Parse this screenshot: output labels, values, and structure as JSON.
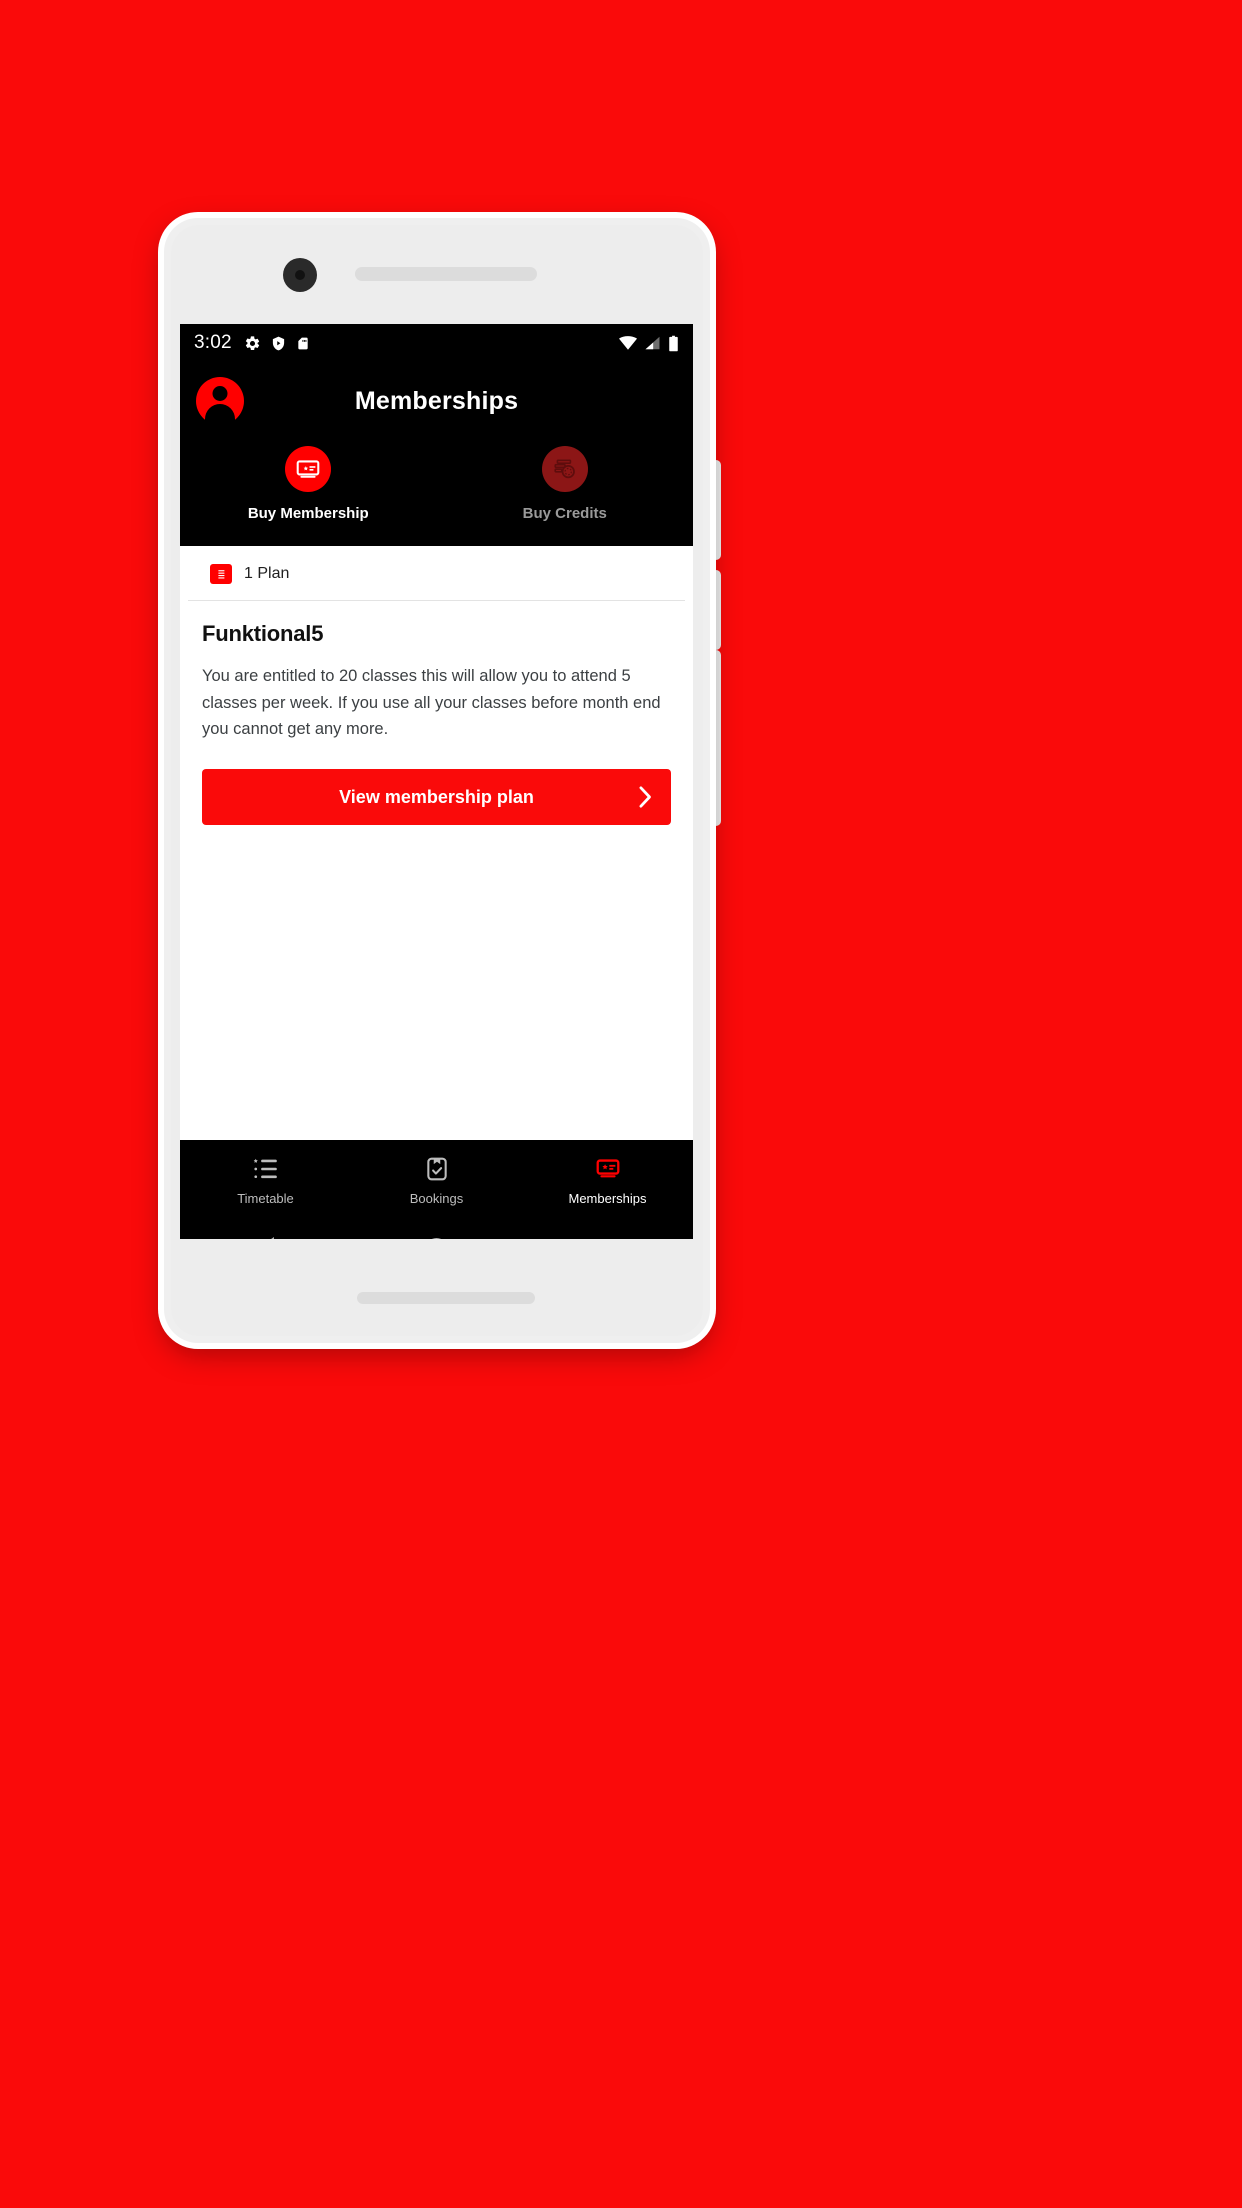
{
  "status_bar": {
    "time": "3:02",
    "left_icons": [
      "gear-icon",
      "shield-play-icon",
      "sd-card-icon"
    ],
    "right_icons": [
      "wifi-icon",
      "cellular-signal-icon",
      "battery-icon"
    ]
  },
  "app_bar": {
    "title": "Memberships",
    "avatar_label": "avatar"
  },
  "quick_actions": [
    {
      "label": "Buy Membership",
      "icon": "membership-card-icon",
      "enabled": true
    },
    {
      "label": "Buy Credits",
      "icon": "credits-coins-icon",
      "enabled": false
    }
  ],
  "plan_list": {
    "count_label": "1 Plan",
    "count_icon": "document-lines-icon"
  },
  "plan": {
    "title": "Funktional5",
    "description": "You are entitled to 20 classes this will allow you to attend 5 classes per week. If you use all your classes before month end you cannot get any more.",
    "cta_label": "View membership plan",
    "cta_icon": "chevron-right-icon"
  },
  "bottom_nav": [
    {
      "label": "Timetable",
      "icon": "list-star-icon",
      "active": false
    },
    {
      "label": "Bookings",
      "icon": "clipboard-check-icon",
      "active": false
    },
    {
      "label": "Memberships",
      "icon": "membership-card-icon",
      "active": true
    }
  ],
  "system_nav": [
    {
      "name": "back-button",
      "icon": "triangle-back-icon"
    },
    {
      "name": "home-button",
      "icon": "circle-home-icon"
    },
    {
      "name": "recents-button",
      "icon": "square-recents-icon"
    }
  ],
  "colors": {
    "background_red": "#FA0A0A",
    "accent_red": "#FF0000",
    "disabled_red": "#8C1616",
    "dark": "#000000",
    "inactive_gray": "#BDBDBD"
  }
}
